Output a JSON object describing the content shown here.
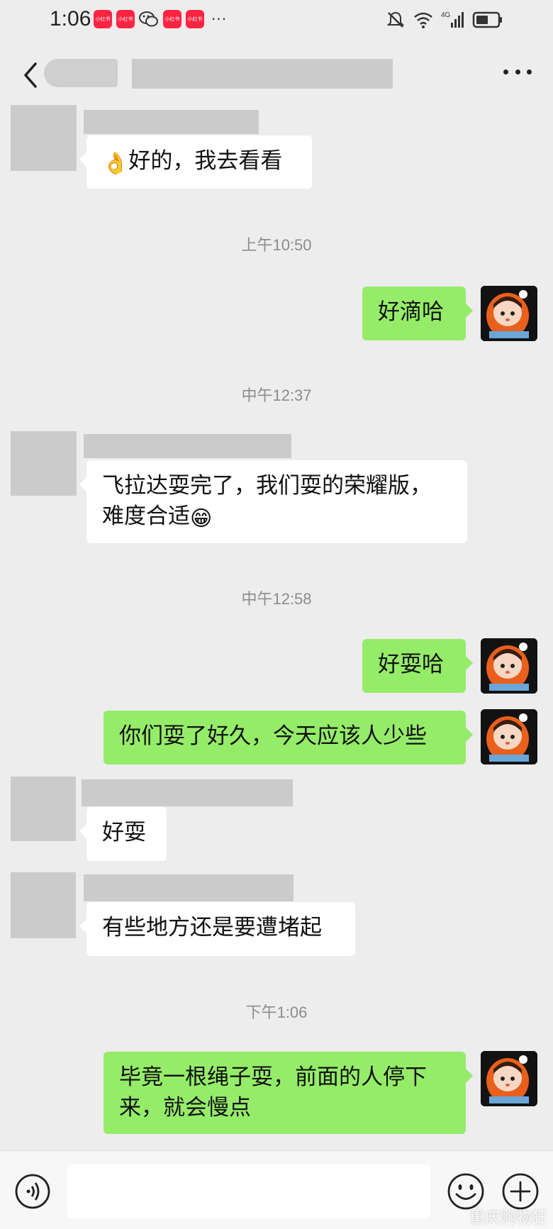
{
  "status_bar": {
    "time": "1:06",
    "app_badge": "小红书",
    "overflow": "···",
    "network": "4G"
  },
  "header": {
    "overflow_icon": "more-dots-icon"
  },
  "messages": [
    {
      "text": "好的，我去看看",
      "emoji": "👌"
    },
    {
      "time": "上午10:50"
    },
    {
      "text": "好滴哈"
    },
    {
      "time": "中午12:37"
    },
    {
      "text_line1": "飞拉达耍完了，我们耍的荣耀版，",
      "text_line2": "难度合适",
      "emoji": "😁"
    },
    {
      "time": "中午12:58"
    },
    {
      "text": "好耍哈"
    },
    {
      "text": "你们耍了好久，今天应该人少些"
    },
    {
      "text": "好耍"
    },
    {
      "text": "有些地方还是要遭堵起"
    },
    {
      "time": "下午1:06"
    },
    {
      "text_line1": "毕竟一根绳子耍，前面的人停下",
      "text_line2": "来，就会慢点"
    }
  ],
  "input_bar": {
    "placeholder": "",
    "watermark": "重庆购物狂"
  },
  "colors": {
    "background": "#ededed",
    "outgoing_bubble": "#95ec69",
    "incoming_bubble": "#ffffff"
  }
}
